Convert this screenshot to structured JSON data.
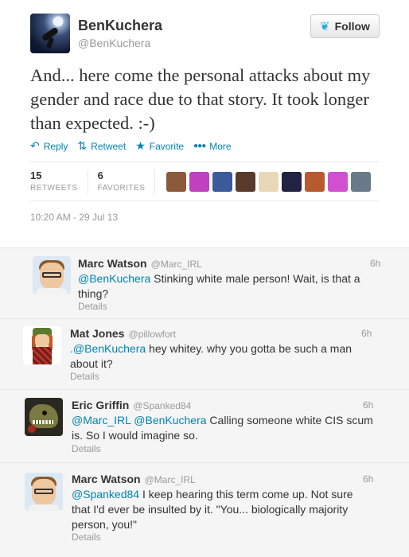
{
  "main_tweet": {
    "name": "BenKuchera",
    "handle": "@BenKuchera",
    "follow_label": "Follow",
    "text": "And... here come the personal attacks about my gender and race due to that story. It took longer than expected. :-)",
    "actions": {
      "reply": "Reply",
      "retweet": "Retweet",
      "favorite": "Favorite",
      "more": "More"
    },
    "stats": {
      "retweets_count": "15",
      "retweets_label": "RETWEETS",
      "favorites_count": "6",
      "favorites_label": "FAVORITES"
    },
    "favoriter_colors": [
      "#8a5a3a",
      "#c040c0",
      "#3a5a9a",
      "#5a3a2a",
      "#e8d8b8",
      "#222244",
      "#b85a30",
      "#d050d0",
      "#6a7a8a"
    ],
    "timestamp": "10:20 AM - 29 Jul 13"
  },
  "replies": [
    {
      "name": "Marc Watson",
      "handle": "@Marc_IRL",
      "time": "6h",
      "mentions": "@BenKuchera",
      "text": " Stinking white male person! Wait, is that a thing?",
      "details": "Details"
    },
    {
      "name": "Mat Jones",
      "handle": "@pillowfort",
      "time": "6h",
      "mentions": ".@BenKuchera",
      "text": " hey whitey. why you gotta be such a man about it?",
      "details": "Details"
    },
    {
      "name": "Eric Griffin",
      "handle": "@Spanked84",
      "time": "6h",
      "mentions": "@Marc_IRL @BenKuchera",
      "text": " Calling someone white CIS scum is. So I would imagine so.",
      "details": "Details"
    },
    {
      "name": "Marc Watson",
      "handle": "@Marc_IRL",
      "time": "6h",
      "mentions": "@Spanked84",
      "text": " I keep hearing this term come up. Not sure that I'd ever be insulted by it. \"You... biologically majority person, you!\"",
      "details": "Details"
    }
  ],
  "colors": {
    "link": "#0084b4",
    "muted": "#999999",
    "twitter_blue": "#2aa9e0"
  }
}
